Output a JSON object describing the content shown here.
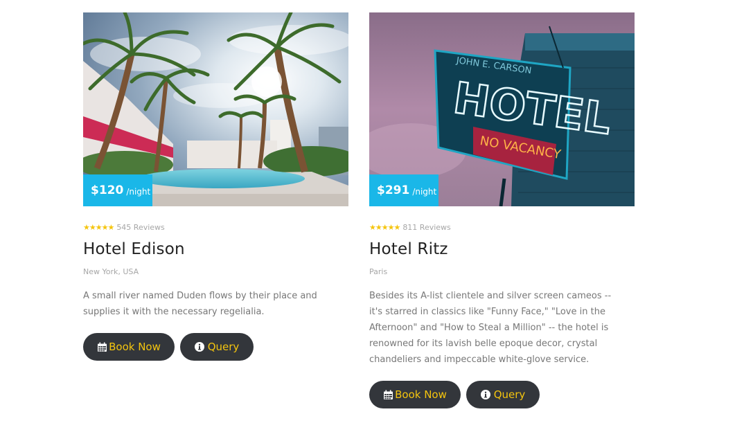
{
  "hotels": [
    {
      "name": "Hotel Edison",
      "price": "$120",
      "price_unit": "/night",
      "stars": "★★★★★",
      "reviews": "545 Reviews",
      "location": "New York, USA",
      "description": "A small river named Duden flows by their place and supplies it with the necessary regelialia.",
      "book_label": "Book Now",
      "query_label": "Query",
      "image": "pool-palm-trees-photo"
    },
    {
      "name": "Hotel Ritz",
      "price": "$291",
      "price_unit": "/night",
      "stars": "★★★★★",
      "reviews": "811 Reviews",
      "location": "Paris",
      "description": "Besides its A-list clientele and silver screen cameos -- it's starred in classics like \"Funny Face,\" \"Love in the Afternoon\" and \"How to Steal a Million\" -- the hotel is renowned for its lavish belle epoque decor, crystal chandeliers and impeccable white-glove service.",
      "book_label": "Book Now",
      "query_label": "Query",
      "image": "neon-hotel-sign-photo",
      "sign_text": "HOTEL",
      "sign_small": "JOHN E. CARSON",
      "sign_vacancy": "NO VACANCY"
    }
  ],
  "colors": {
    "accent": "#1ab7e8",
    "button_bg": "#33363b",
    "button_text": "#f5c50e",
    "star": "#f5c50e"
  },
  "icons": {
    "book": "calendar-icon",
    "query": "info-circle-icon"
  }
}
